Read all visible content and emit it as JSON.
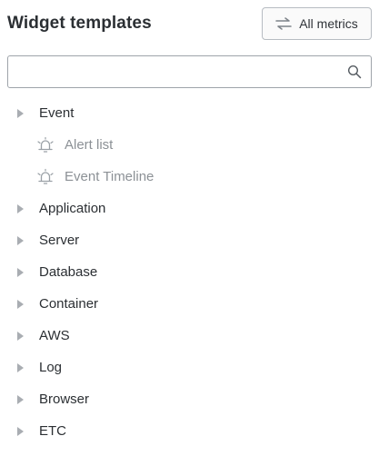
{
  "header": {
    "title": "Widget templates",
    "all_metrics_label": "All metrics",
    "all_metrics_icon": "swap-arrows-icon"
  },
  "search": {
    "placeholder": "",
    "value": "",
    "icon": "search-icon"
  },
  "tree": {
    "event": {
      "label": "Event",
      "children": [
        {
          "label": "Alert list",
          "icon": "alarm-bell-icon"
        },
        {
          "label": "Event Timeline",
          "icon": "alarm-bell-icon"
        }
      ]
    },
    "categories": [
      {
        "label": "Application"
      },
      {
        "label": "Server"
      },
      {
        "label": "Database"
      },
      {
        "label": "Container"
      },
      {
        "label": "AWS"
      },
      {
        "label": "Log"
      },
      {
        "label": "Browser"
      },
      {
        "label": "ETC"
      }
    ]
  },
  "colors": {
    "text": "#2b2f33",
    "muted_text": "#8c9196",
    "caret": "#a9adb2",
    "border": "#b7bcc2"
  }
}
